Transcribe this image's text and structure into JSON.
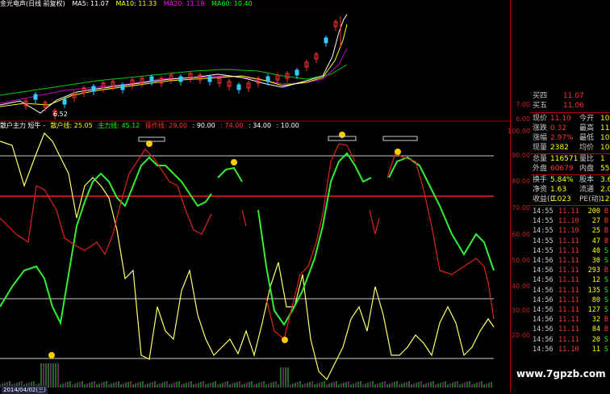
{
  "header": {
    "title": "金光电声(日线 前复权)",
    "ma5": "MA5: 11.07",
    "ma10": "MA10: 11.33",
    "ma20": "MA20: 11.19",
    "ma60": "MA60: 10.40",
    "low_label": "6.52"
  },
  "indicator": {
    "name": "散户主力 短牛 -",
    "retail": "散户线: 25.05",
    "main": "主力线: 45.12",
    "op": "操作线: 29.00",
    "v90": ": 90.00",
    "v74": ": 74.00",
    "v34": ": 34.00",
    "v10": ": 10.00"
  },
  "axis": {
    "price_labels": [
      "7.00",
      "6.00"
    ],
    "ind_labels": [
      "100.00",
      "90.00",
      "80.00",
      "70.00",
      "60.00",
      "50.00",
      "40.00",
      "30.00",
      "20.00"
    ]
  },
  "quote": {
    "rows": [
      {
        "l": "买四",
        "v": "11.07",
        "vc": "#ff3333"
      },
      {
        "l": "买五",
        "v": "11.06",
        "vc": "#ff3333"
      }
    ],
    "stats": [
      {
        "l1": "现价",
        "v1": "11.10",
        "c1": "#ff3333",
        "l2": "今开",
        "v2": "10"
      },
      {
        "l1": "涨跌",
        "v1": "0.32",
        "c1": "#ff3333",
        "l2": "最高",
        "v2": "11"
      },
      {
        "l1": "涨幅",
        "v1": "2.97%",
        "c1": "#ff3333",
        "l2": "最低",
        "v2": "10"
      },
      {
        "l1": "现量",
        "v1": "2382",
        "c1": "#ffff00",
        "l2": "均价",
        "v2": "10"
      },
      {
        "l1": "总量",
        "v1": "116571",
        "c1": "#ffff00",
        "l2": "量比",
        "v2": "1"
      },
      {
        "l1": "外盘",
        "v1": "60679",
        "c1": "#ff3333",
        "l2": "内盘",
        "v2": "55"
      },
      {
        "l1": "换手",
        "v1": "5.84%",
        "c1": "#ffff00",
        "l2": "股本",
        "v2": "3.6"
      },
      {
        "l1": "净资",
        "v1": "1.63",
        "c1": "#ffff00",
        "l2": "流通",
        "v2": "2.0"
      },
      {
        "l1": "收益(二",
        "v1": "0.023",
        "c1": "#ffff00",
        "l2": "PE(动)",
        "v2": "12"
      }
    ],
    "ticks": [
      {
        "t": "14:55",
        "p": "11.11",
        "v": "200",
        "d": "B"
      },
      {
        "t": "14:55",
        "p": "11.10",
        "v": "27",
        "d": "B"
      },
      {
        "t": "14:55",
        "p": "11.10",
        "v": "25",
        "d": "B"
      },
      {
        "t": "14:55",
        "p": "11.11",
        "v": "47",
        "d": "B"
      },
      {
        "t": "14:55",
        "p": "11.11",
        "v": "40",
        "d": "S"
      },
      {
        "t": "14:56",
        "p": "11.11",
        "v": "30",
        "d": "S"
      },
      {
        "t": "14:56",
        "p": "11.11",
        "v": "293",
        "d": "B"
      },
      {
        "t": "14:56",
        "p": "11.11",
        "v": "12",
        "d": "S"
      },
      {
        "t": "14:56",
        "p": "11.11",
        "v": "135",
        "d": "S"
      },
      {
        "t": "14:56",
        "p": "11.11",
        "v": "80",
        "d": "S"
      },
      {
        "t": "14:56",
        "p": "11.11",
        "v": "127",
        "d": "S"
      },
      {
        "t": "14:56",
        "p": "11.11",
        "v": "32",
        "d": "B"
      },
      {
        "t": "14:56",
        "p": "11.11",
        "v": "84",
        "d": "B"
      },
      {
        "t": "14:56",
        "p": "11.11",
        "v": "20",
        "d": "S"
      },
      {
        "t": "14:56",
        "p": "11.10",
        "v": "11",
        "d": "S"
      }
    ]
  },
  "watermark": "www.7gpzb.com",
  "bottom": "2014/04/02(三)"
}
